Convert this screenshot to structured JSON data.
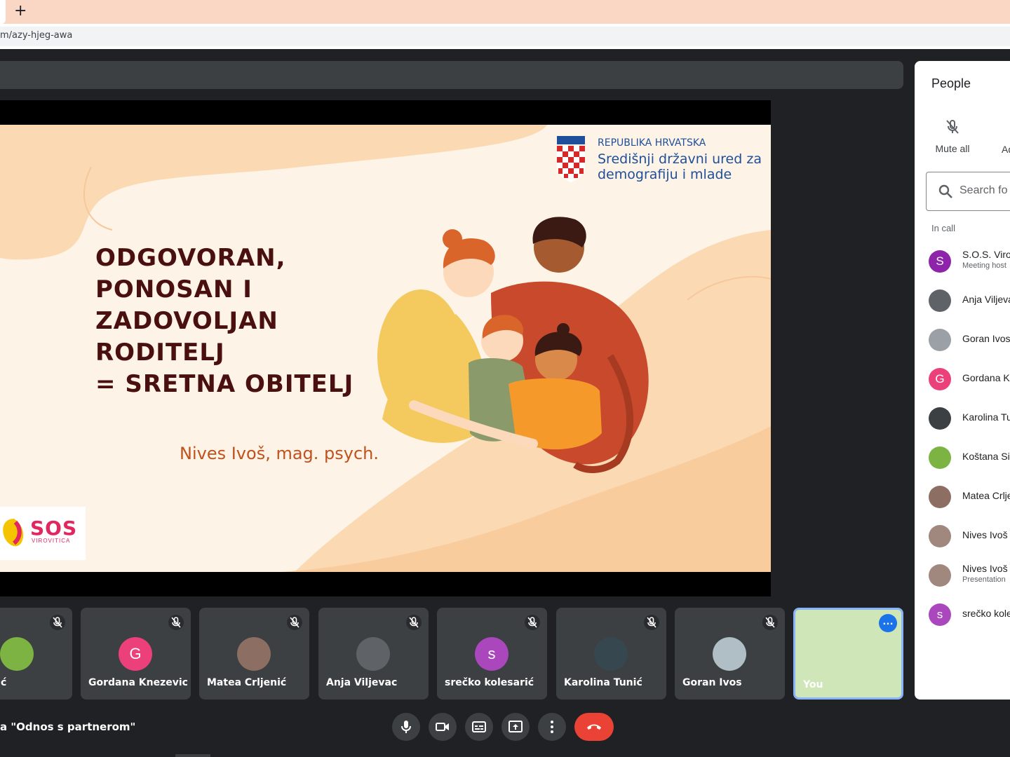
{
  "browser": {
    "new_tab_label": "+",
    "url": "m/azy-hjeg-awa"
  },
  "slide": {
    "headline_lines": [
      "ODGOVORAN,",
      "PONOSAN I",
      "ZADOVOLJAN",
      "RODITELJ",
      "= SRETNA OBITELJ"
    ],
    "author": "Nives Ivoš, mag. psych.",
    "gov_line1": "REPUBLIKA HRVATSKA",
    "gov_line2": "Središnji državni ured za demografiju i mlade",
    "sos_logo_text": "SOS",
    "sos_logo_sub": "VIROVITICA"
  },
  "people_panel": {
    "title": "People",
    "mute_all_label": "Mute all",
    "add_label": "Ad",
    "search_placeholder": "Search fo",
    "in_call_label": "In call",
    "participants": [
      {
        "name": "S.O.S. Virov",
        "subtitle": "Meeting host",
        "initial": "S",
        "color": "#8e24aa"
      },
      {
        "name": "Anja Viljeva",
        "subtitle": "",
        "initial": "",
        "color": "#5f6368"
      },
      {
        "name": "Goran Ivos",
        "subtitle": "",
        "initial": "",
        "color": "#9aa0a6"
      },
      {
        "name": "Gordana K",
        "subtitle": "",
        "initial": "G",
        "color": "#ec407a"
      },
      {
        "name": "Karolina Tu",
        "subtitle": "",
        "initial": "",
        "color": "#3c4043"
      },
      {
        "name": "Koštana Sip",
        "subtitle": "",
        "initial": "",
        "color": "#7cb342"
      },
      {
        "name": "Matea Crlje",
        "subtitle": "",
        "initial": "",
        "color": "#8d6e63"
      },
      {
        "name": "Nives Ivoš",
        "subtitle": "",
        "initial": "",
        "color": "#a1887f"
      },
      {
        "name": "Nives Ivoš",
        "subtitle": "Presentation",
        "initial": "",
        "color": "#a1887f"
      },
      {
        "name": "srečko kole",
        "subtitle": "",
        "initial": "s",
        "color": "#ab47bc"
      }
    ]
  },
  "tiles": [
    {
      "name": "a Sipić",
      "initial": "",
      "color": "#7cb342"
    },
    {
      "name": "Gordana Knezevic",
      "initial": "G",
      "color": "#ec407a"
    },
    {
      "name": "Matea Crljenić",
      "initial": "",
      "color": "#8d6e63"
    },
    {
      "name": "Anja Viljevac",
      "initial": "",
      "color": "#5f6368"
    },
    {
      "name": "srečko kolesarić",
      "initial": "s",
      "color": "#ab47bc"
    },
    {
      "name": "Karolina Tunić",
      "initial": "",
      "color": "#37474f"
    },
    {
      "name": "Goran Ivos",
      "initial": "",
      "color": "#b0bec5"
    },
    {
      "name": "You",
      "initial": "",
      "color": "#cfe6b8"
    }
  ],
  "meeting_title": "a \"Odnos s partnerom\"",
  "controls": {
    "mic": "microphone",
    "camera": "camera",
    "captions": "captions",
    "present": "present-screen",
    "more": "more-options",
    "end": "end-call"
  },
  "colors": {
    "meet_bg": "#202124",
    "tile_bg": "#3c4043",
    "end_call": "#ea4335",
    "self_border": "#8ab4f8",
    "headline": "#4a1010",
    "author": "#c0521e",
    "gov_blue": "#1f4f9a"
  }
}
